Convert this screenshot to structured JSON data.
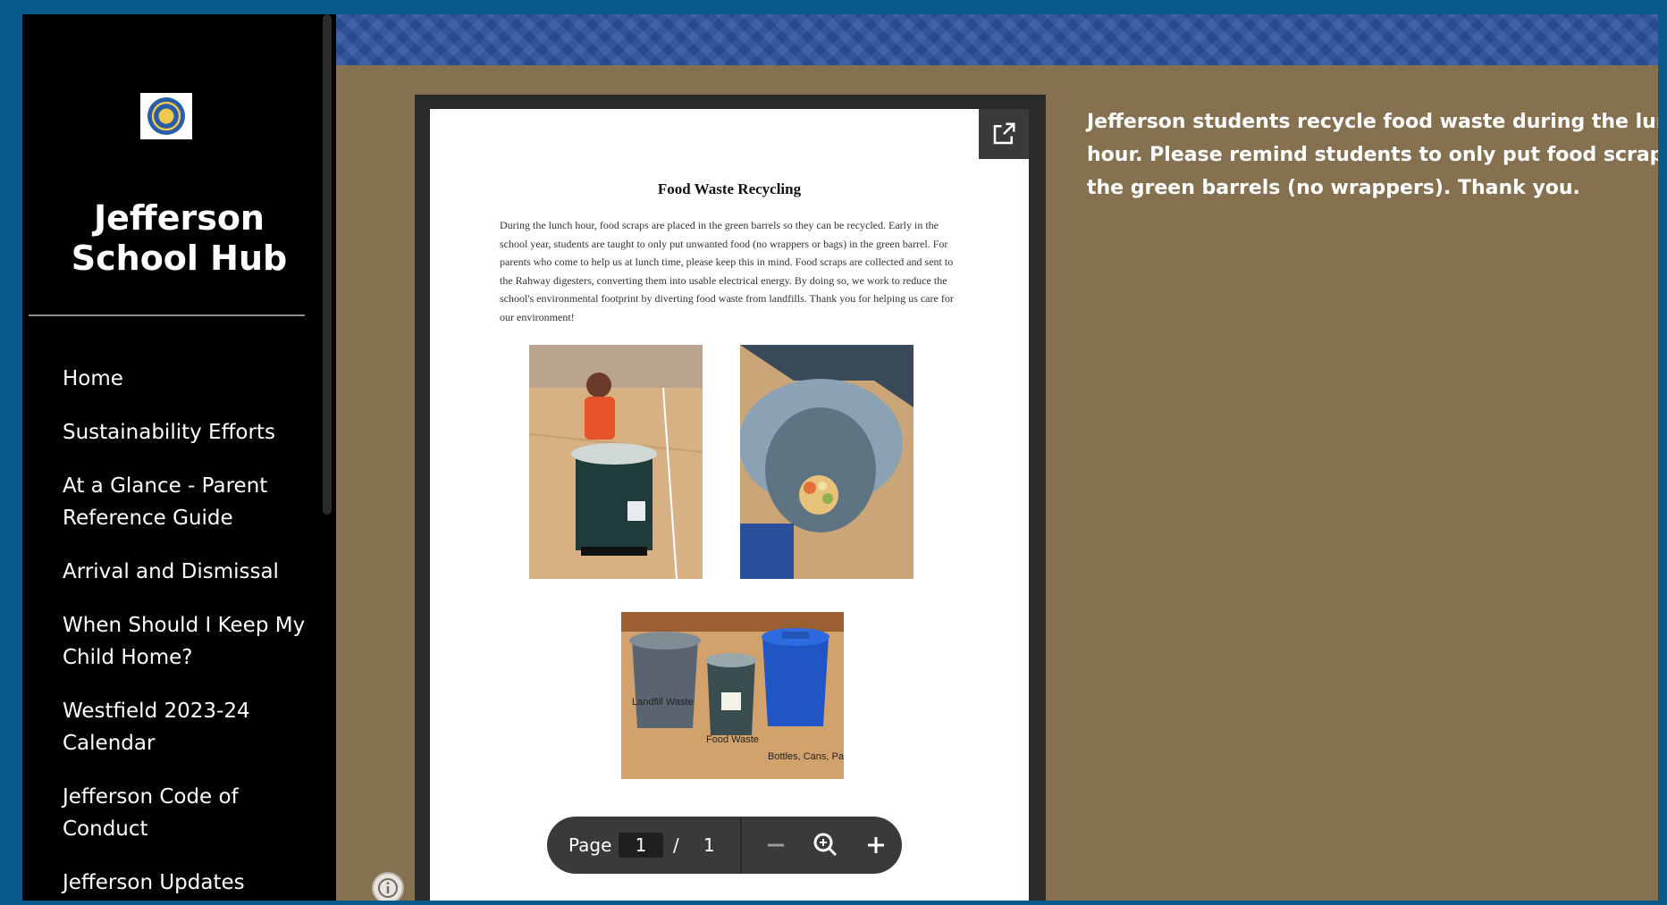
{
  "sidebar": {
    "logo_icon": "school-seal-icon",
    "title": "Jefferson\nSchool Hub",
    "nav_items": [
      {
        "label": "Home"
      },
      {
        "label": "Sustainability Efforts"
      },
      {
        "label": "At a Glance - Parent Reference Guide"
      },
      {
        "label": "Arrival and Dismissal"
      },
      {
        "label": "When Should I Keep My Child Home?"
      },
      {
        "label": "Westfield 2023-24 Calendar"
      },
      {
        "label": "Jefferson Code of Conduct"
      },
      {
        "label": "Jefferson Updates"
      }
    ]
  },
  "pdf": {
    "title": "Food Waste Recycling",
    "body": "During the lunch hour, food scraps are placed in the green barrels so they can be recycled. Early in the school year, students are taught to only put unwanted food (no wrappers or bags) in the green barrel. For parents who come to help us at lunch time, please keep this in mind. Food scraps are collected and sent to the Rahway digesters, converting them into usable electrical energy. By doing so, we work to reduce the school's environmental footprint by diverting food waste from landfills. Thank you for helping us care for our environment!",
    "photo_labels": {
      "landfill": "Landfill Waste",
      "food": "Food Waste",
      "bottles": "Bottles, Cans, Paper"
    },
    "toolbar": {
      "page_label": "Page",
      "current_page": "1",
      "separator": "/",
      "total_pages": "1"
    }
  },
  "description_lines": [
    "Jefferson students recycle food waste during the lunch",
    "hour. Please remind students to only put food scraps in",
    "the green barrels (no wrappers). Thank you."
  ],
  "colors": {
    "sidebar_bg": "#000000",
    "main_bg": "#857150",
    "header_strip": "#2d52a0",
    "page_border": "#0b5a8c"
  }
}
